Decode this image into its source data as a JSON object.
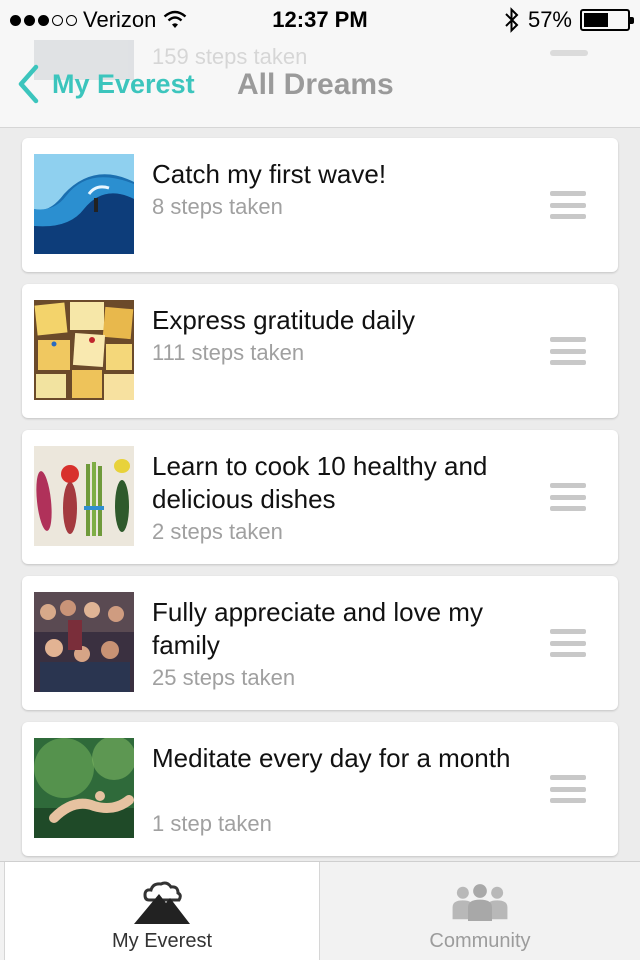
{
  "status_bar": {
    "carrier": "Verizon",
    "time": "12:37 PM",
    "battery_percent": "57%",
    "battery_level": 0.57,
    "signal_bars_filled": 3,
    "signal_bars_total": 5
  },
  "nav": {
    "back_label": "My Everest",
    "title": "All Dreams",
    "ghost_row_text": "159 steps taken"
  },
  "colors": {
    "accent": "#3cc5bd",
    "title_gray": "#9a9a9a",
    "subtitle_gray": "#a0a0a0"
  },
  "dreams": [
    {
      "title": "Catch my first wave!",
      "steps": "8 steps taken",
      "image": "surfing-wave"
    },
    {
      "title": "Express gratitude daily",
      "steps": "111 steps taken",
      "image": "sticky-notes-board"
    },
    {
      "title": "Learn to cook 10 healthy and delicious dishes",
      "steps": "2 steps taken",
      "image": "vegetables"
    },
    {
      "title": "Fully appreciate and love my family",
      "steps": "25 steps taken",
      "image": "family-photo"
    },
    {
      "title": "Meditate every day for a month",
      "steps": "1 step taken",
      "image": "meditation"
    }
  ],
  "tabs": [
    {
      "label": "My Everest",
      "icon": "mountain-cloud-icon",
      "active": true
    },
    {
      "label": "Community",
      "icon": "people-group-icon",
      "active": false
    }
  ]
}
